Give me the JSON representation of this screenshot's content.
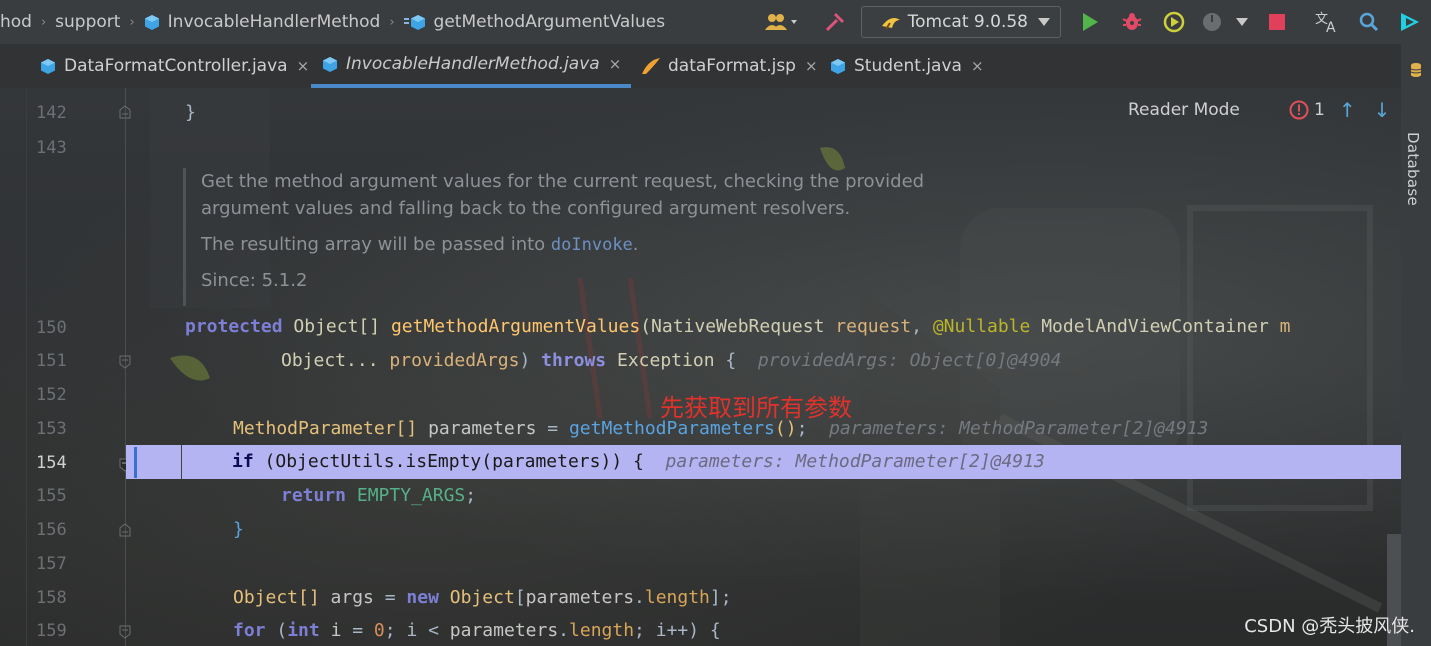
{
  "topbar": {
    "breadcrumbs": [
      "hod",
      "support",
      "InvocableHandlerMethod",
      "getMethodArgumentValues"
    ],
    "run_config": "Tomcat 9.0.58",
    "icons": [
      "users-icon",
      "build-hammer-icon",
      "run-icon",
      "debug-icon",
      "coverage-icon",
      "profiler-icon",
      "stop-icon",
      "translate-icon",
      "search-icon",
      "jetbrains-logo-icon"
    ]
  },
  "tabs": [
    {
      "label": "DataFormatController.java",
      "icon": "java-class-icon",
      "active": false
    },
    {
      "label": "InvocableHandlerMethod.java",
      "icon": "java-class-icon",
      "active": true
    },
    {
      "label": "dataFormat.jsp",
      "icon": "jsp-icon",
      "active": false
    },
    {
      "label": "Student.java",
      "icon": "java-class-icon",
      "active": false
    }
  ],
  "tab_close": "×",
  "right_panel": {
    "label": "Database"
  },
  "editor": {
    "reader_mode": "Reader Mode",
    "problems_count": "1",
    "line_numbers": [
      "142",
      "143",
      "150",
      "151",
      "152",
      "153",
      "154",
      "155",
      "156",
      "157",
      "158",
      "159"
    ],
    "doc": {
      "line1": "Get the method argument values for the current request, checking the provided",
      "line2": "argument values and falling back to the configured argument resolvers.",
      "line3_prefix": "The resulting array will be passed into ",
      "line3_link": "doInvoke",
      "line3_suffix": ".",
      "since": "Since: 5.1.2"
    },
    "code": {
      "l142": "}",
      "l150_kw": "protected",
      "l150_type": "Object[]",
      "l150_fn": "getMethodArgumentValues",
      "l150_ptype": "(NativeWebRequest",
      "l150_pname": "request",
      "l150_ann": "@Nullable",
      "l150_ptype2": "ModelAndViewContainer",
      "l150_tail": "m",
      "l151_type": "Object...",
      "l151_pname": "providedArgs",
      "l151_throws": "throws",
      "l151_ex": "Exception",
      "l151_hint": "providedArgs: Object[0]@4904",
      "l153_type": "MethodParameter[]",
      "l153_var": "parameters",
      "l153_call": "getMethodParameters",
      "l153_hint": "parameters: MethodParameter[2]@4913",
      "l154_kw": "if",
      "l154_rest": "(ObjectUtils.isEmpty(parameters)) {",
      "l154_hint": "parameters: MethodParameter[2]@4913",
      "l155_kw": "return",
      "l155_const": "EMPTY_ARGS",
      "l156": "}",
      "l158_type": "Object[]",
      "l158_var": "args",
      "l158_new": "new",
      "l158_type2": "Object",
      "l158_param": "parameters",
      "l158_field": "length",
      "l159_kw": "for",
      "l159_int": "int",
      "l159_i": "i",
      "l159_zero": "0",
      "l159_params": "parameters",
      "l159_len": "length",
      "l159_tail": "i++) {"
    },
    "annotation_cn": "先获取到所有参数"
  },
  "watermark": "CSDN @秃头披风侠.",
  "colors": {
    "keyword": "#cc7832",
    "function": "#ffc66d",
    "highlight": "#b4b4f3",
    "accent_tab": "#4a88c7",
    "note": "#e0322b"
  }
}
